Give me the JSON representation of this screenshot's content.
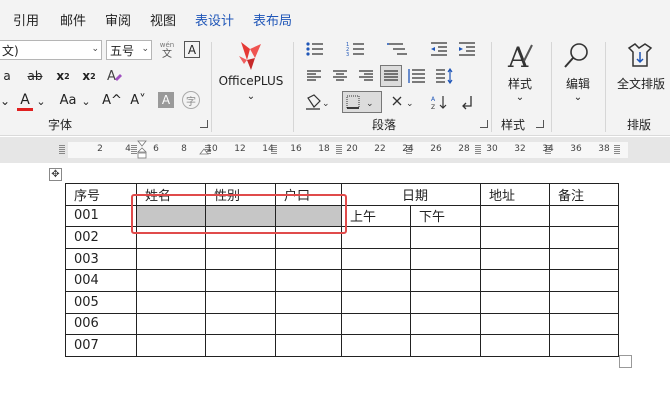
{
  "tabs": [
    "引用",
    "邮件",
    "审阅",
    "视图",
    "表设计",
    "表布局"
  ],
  "font": {
    "family_value": "文)",
    "size_value": "五号",
    "pinyin_top": "wén",
    "pinyin_bottom": "文",
    "char_border": "A",
    "font_color_letter": "A",
    "change_case": "Aa",
    "grow": "A^",
    "shrink": "A˅",
    "shade_letter": "A",
    "enclose": "字",
    "group_label": "字体"
  },
  "officeplus": {
    "label": "OfficePLUS"
  },
  "paragraph": {
    "group_label": "段落"
  },
  "styles": {
    "label": "样式",
    "group_label": "样式"
  },
  "edit": {
    "label": "编辑"
  },
  "arrange": {
    "label": "全文排版",
    "group_label": "排版"
  },
  "ruler": {
    "ticks": [
      "2",
      "4",
      "6",
      "8",
      "10",
      "12",
      "14",
      "16",
      "18",
      "20",
      "22",
      "24",
      "26",
      "28",
      "30",
      "32",
      "34",
      "36",
      "38"
    ]
  },
  "table": {
    "headers": [
      "序号",
      "姓名",
      "性别",
      "户口",
      "日期",
      "地址",
      "备注"
    ],
    "date_sub": [
      "上午",
      "下午"
    ],
    "rows": [
      "001",
      "002",
      "003",
      "004",
      "005",
      "006",
      "007"
    ]
  },
  "colors": {
    "accent_blue": "#1f56b8",
    "selection_red": "#e04b4b",
    "cell_gray": "#c6c6c6",
    "font_red": "#e02020"
  }
}
